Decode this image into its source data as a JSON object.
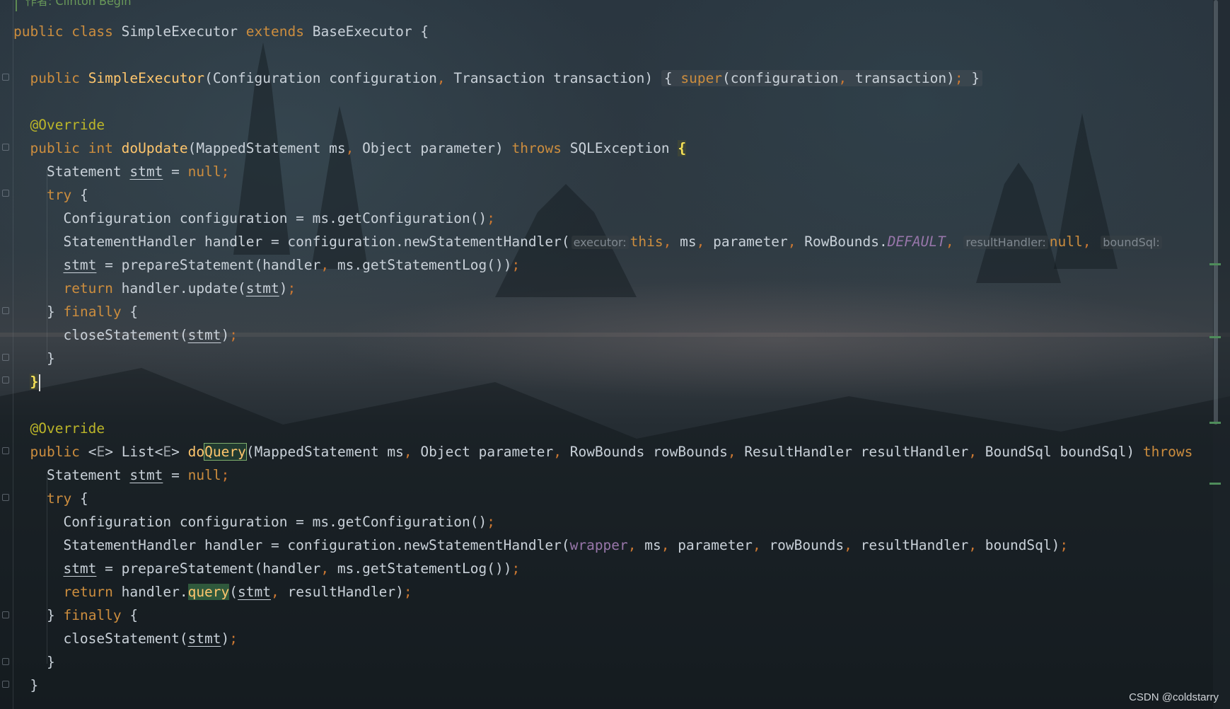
{
  "author_hint": "作者: Clinton Begin",
  "watermark": "CSDN @coldstarry",
  "code": {
    "l1": {
      "kw_public": "public",
      "kw_class": "class",
      "name": "SimpleExecutor",
      "kw_extends": "extends",
      "base": "BaseExecutor",
      "brace": "{"
    },
    "l2": {
      "kw_public": "public",
      "ctor": "SimpleExecutor",
      "open": "(",
      "t1": "Configuration",
      "p1": "configuration",
      "comma1": ",",
      "t2": "Transaction",
      "p2": "transaction",
      "close": ")",
      "body_open": "{",
      "kw_super": "super",
      "args": "(configuration",
      "comma2": ",",
      "arg2": "transaction)",
      "semi": ";",
      "body_close": "}"
    },
    "l3": {
      "annotation": "@Override"
    },
    "l4": {
      "kw_public": "public",
      "kw_int": "int",
      "method": "doUpdate",
      "params": "(MappedStatement ms",
      "comma": ",",
      "params2": "Object parameter)",
      "kw_throws": "throws",
      "exc": "SQLException",
      "brace": "{"
    },
    "l5": {
      "type": "Statement",
      "var": "stmt",
      "eq": "=",
      "kw_null": "null",
      "semi": ";"
    },
    "l6": {
      "kw_try": "try",
      "brace": "{"
    },
    "l7": {
      "text": "Configuration configuration = ms.getConfiguration()",
      "semi": ";"
    },
    "l8": {
      "pre": "StatementHandler handler = configuration.newStatementHandler(",
      "hint_executor": "executor:",
      "kw_this": "this",
      "c1": ",",
      "ms": "ms",
      "c2": ",",
      "param": "parameter",
      "c3": ",",
      "rb": "RowBounds.",
      "default": "DEFAULT",
      "c4": ",",
      "hint_rh": "resultHandler:",
      "kw_null": "null",
      "c5": ",",
      "hint_bs": "boundSql:"
    },
    "l9": {
      "var": "stmt",
      "mid": "= prepareStatement(handler",
      "comma": ",",
      "rest": "ms.getStatementLog())",
      "semi": ";"
    },
    "l10": {
      "kw_return": "return",
      "mid": "handler.update(",
      "var": "stmt",
      "close": ")",
      "semi": ";"
    },
    "l11": {
      "open": "}",
      "kw_finally": "finally",
      "brace": "{"
    },
    "l12": {
      "mid": "closeStatement(",
      "var": "stmt",
      "close": ")",
      "semi": ";"
    },
    "l13": {
      "brace": "}"
    },
    "l14": {
      "brace": "}"
    },
    "l15": {
      "annotation": "@Override"
    },
    "l16": {
      "kw_public": "public",
      "lt": "<",
      "tE": "E",
      "gt": ">",
      "list": "List",
      "lt2": "<",
      "tE2": "E",
      "gt2": ">",
      "m1": "do",
      "m2": "Query",
      "p1": "(MappedStatement ms",
      "c1": ",",
      "p2": "Object parameter",
      "c2": ",",
      "p3": "RowBounds rowBounds",
      "c3": ",",
      "p4": "ResultHandler resultHandler",
      "c4": ",",
      "p5": "BoundSql boundSql)",
      "kw_throws": "throws"
    },
    "l17": {
      "type": "Statement",
      "var": "stmt",
      "eq": "=",
      "kw_null": "null",
      "semi": ";"
    },
    "l18": {
      "kw_try": "try",
      "brace": "{"
    },
    "l19": {
      "text": "Configuration configuration = ms.getConfiguration()",
      "semi": ";"
    },
    "l20": {
      "pre": "StatementHandler handler = configuration.newStatementHandler(",
      "wrapper": "wrapper",
      "c1": ",",
      "a1": "ms",
      "c2": ",",
      "a2": "parameter",
      "c3": ",",
      "a3": "rowBounds",
      "c4": ",",
      "a4": "resultHandler",
      "c5": ",",
      "a5": "boundSql)",
      "semi": ";"
    },
    "l21": {
      "var": "stmt",
      "mid": "= prepareStatement(handler",
      "comma": ",",
      "rest": "ms.getStatementLog())",
      "semi": ";"
    },
    "l22": {
      "kw_return": "return",
      "mid": "handler.",
      "call": "query",
      "open": "(",
      "var": "stmt",
      "comma": ",",
      "rest": "resultHandler)",
      "semi": ";"
    },
    "l23": {
      "open": "}",
      "kw_finally": "finally",
      "brace": "{"
    },
    "l24": {
      "mid": "closeStatement(",
      "var": "stmt",
      "close": ")",
      "semi": ";"
    },
    "l25": {
      "brace": "}"
    },
    "l26": {
      "brace": "}"
    }
  }
}
